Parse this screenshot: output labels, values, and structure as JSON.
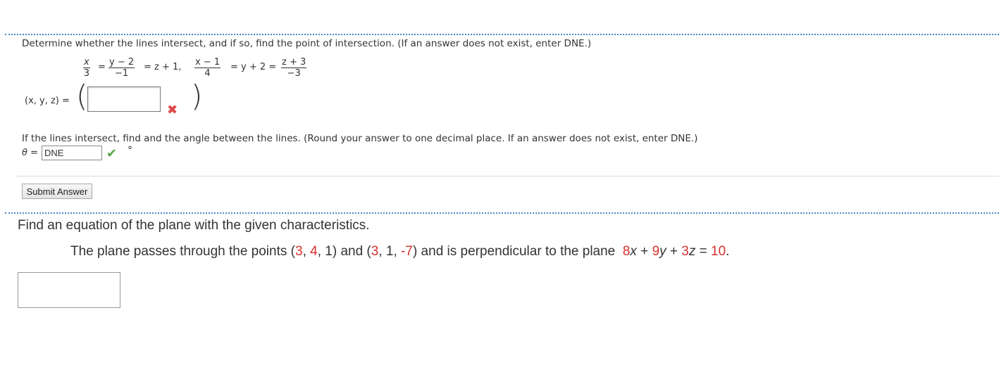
{
  "q1": {
    "prompt": "Determine whether the lines intersect, and if so, find the point of intersection. (If an answer does not exist, enter DNE.)",
    "eq": {
      "f1_num": "x",
      "f1_den": "3",
      "eq_sign1": "=",
      "f2_num": "y − 2",
      "f2_den": "−1",
      "mid1": "= z + 1,",
      "f3_num": "x − 1",
      "f3_den": "4",
      "mid2": "= y + 2 =",
      "f4_num": "z + 3",
      "f4_den": "−3"
    },
    "point_label": "(x, y, z) =",
    "point_value": "",
    "point_status": "incorrect",
    "angle_prompt": "If the lines intersect, find and the angle between the lines. (Round your answer to one decimal place. If an answer does not exist, enter DNE.)",
    "theta_label": "θ =",
    "theta_value": "DNE",
    "theta_status": "correct",
    "degree_unit": "°",
    "submit_label": "Submit Answer"
  },
  "q2": {
    "title": "Find an equation of the plane with the given characteristics.",
    "body_prefix": "The plane passes through the points (",
    "p1": [
      "3",
      "4",
      "1"
    ],
    "p2": [
      "3",
      "1",
      "-7"
    ],
    "mid": ") and is perpendicular to the plane",
    "plane_coef": [
      "8",
      "9",
      "3"
    ],
    "plane_rhs": "10",
    "answer_value": ""
  },
  "colors": {
    "accent_red": "#d9302c",
    "check_green": "#5aa34a",
    "cross_red": "#e04545",
    "dotted_blue": "#4a86c8"
  }
}
